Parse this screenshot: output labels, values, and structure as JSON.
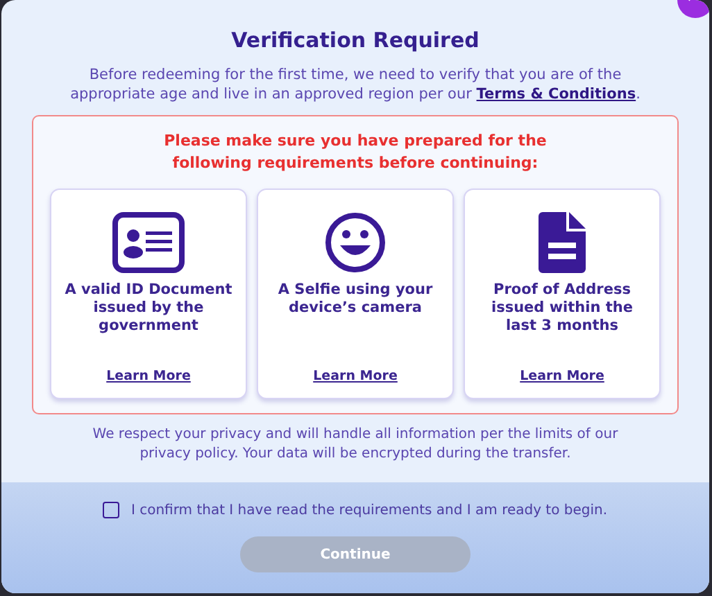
{
  "dialog": {
    "title": "Verification Required",
    "intro": {
      "before": "Before redeeming for the first time, we need to verify that you are of the appropriate age and live in an approved region per our ",
      "link": "Terms & Conditions",
      "after": "."
    }
  },
  "requirements": {
    "heading": "Please make sure you have prepared for the following requirements before continuing:",
    "items": [
      {
        "kind": "id",
        "label": "A valid ID Document issued by the government",
        "link": "Learn More"
      },
      {
        "kind": "selfie",
        "label": "A Selfie using your device’s camera",
        "link": "Learn More"
      },
      {
        "kind": "document",
        "label": "Proof of Address issued within the last 3 months",
        "link": "Learn More"
      }
    ]
  },
  "privacy_note": "We respect your privacy and will handle all information per the limits of our privacy policy. Your data will be encrypted during the transfer.",
  "confirm": {
    "label": "I confirm that I have read the requirements and I am ready to begin.",
    "checked": false
  },
  "continue_button": {
    "label": "Continue",
    "disabled": true
  }
}
